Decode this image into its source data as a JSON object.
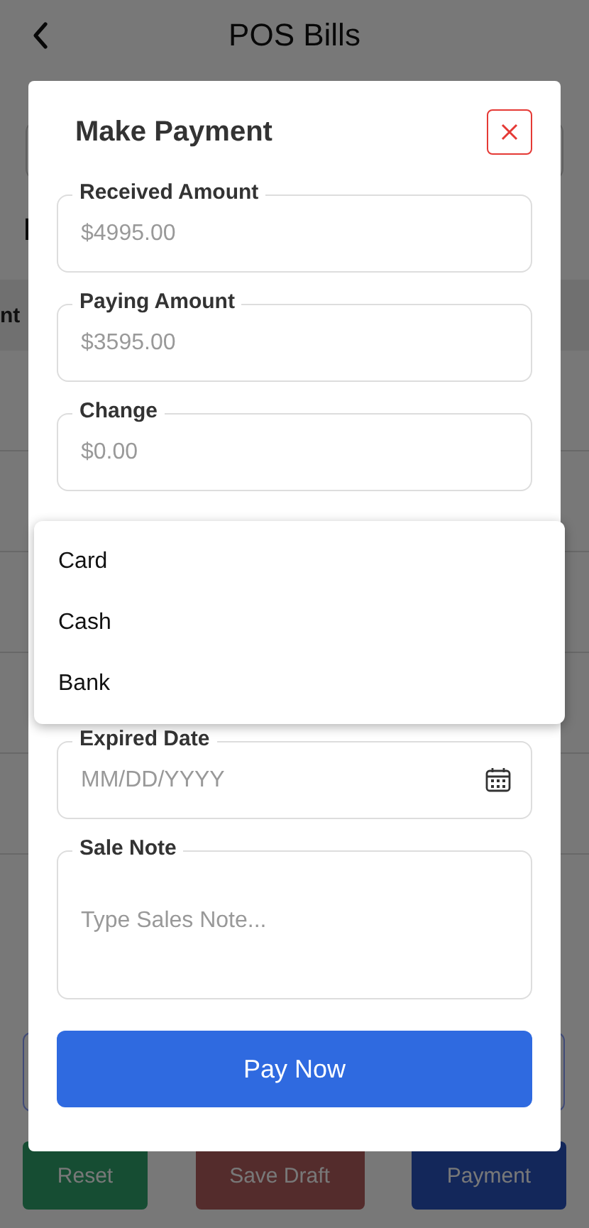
{
  "header": {
    "title": "POS Bills"
  },
  "background": {
    "heading_fragment": "I",
    "column_fragment": "nt",
    "buttons": [
      {
        "label": "Reset",
        "kind": "reset"
      },
      {
        "label": "Save Draft",
        "kind": "draft"
      },
      {
        "label": "Payment",
        "kind": "payment"
      }
    ]
  },
  "modal": {
    "title": "Make Payment",
    "fields": [
      {
        "label": "Received Amount",
        "placeholder": "$4995.00"
      },
      {
        "label": "Paying Amount",
        "placeholder": "$3595.00"
      },
      {
        "label": "Change",
        "placeholder": "$0.00"
      }
    ],
    "expired_date": {
      "label": "Expired Date",
      "placeholder": "MM/DD/YYYY"
    },
    "sale_note": {
      "label": "Sale Note",
      "placeholder": "Type Sales Note..."
    },
    "pay_button": "Pay Now"
  },
  "dropdown": {
    "options": [
      "Card",
      "Cash",
      "Bank"
    ]
  }
}
